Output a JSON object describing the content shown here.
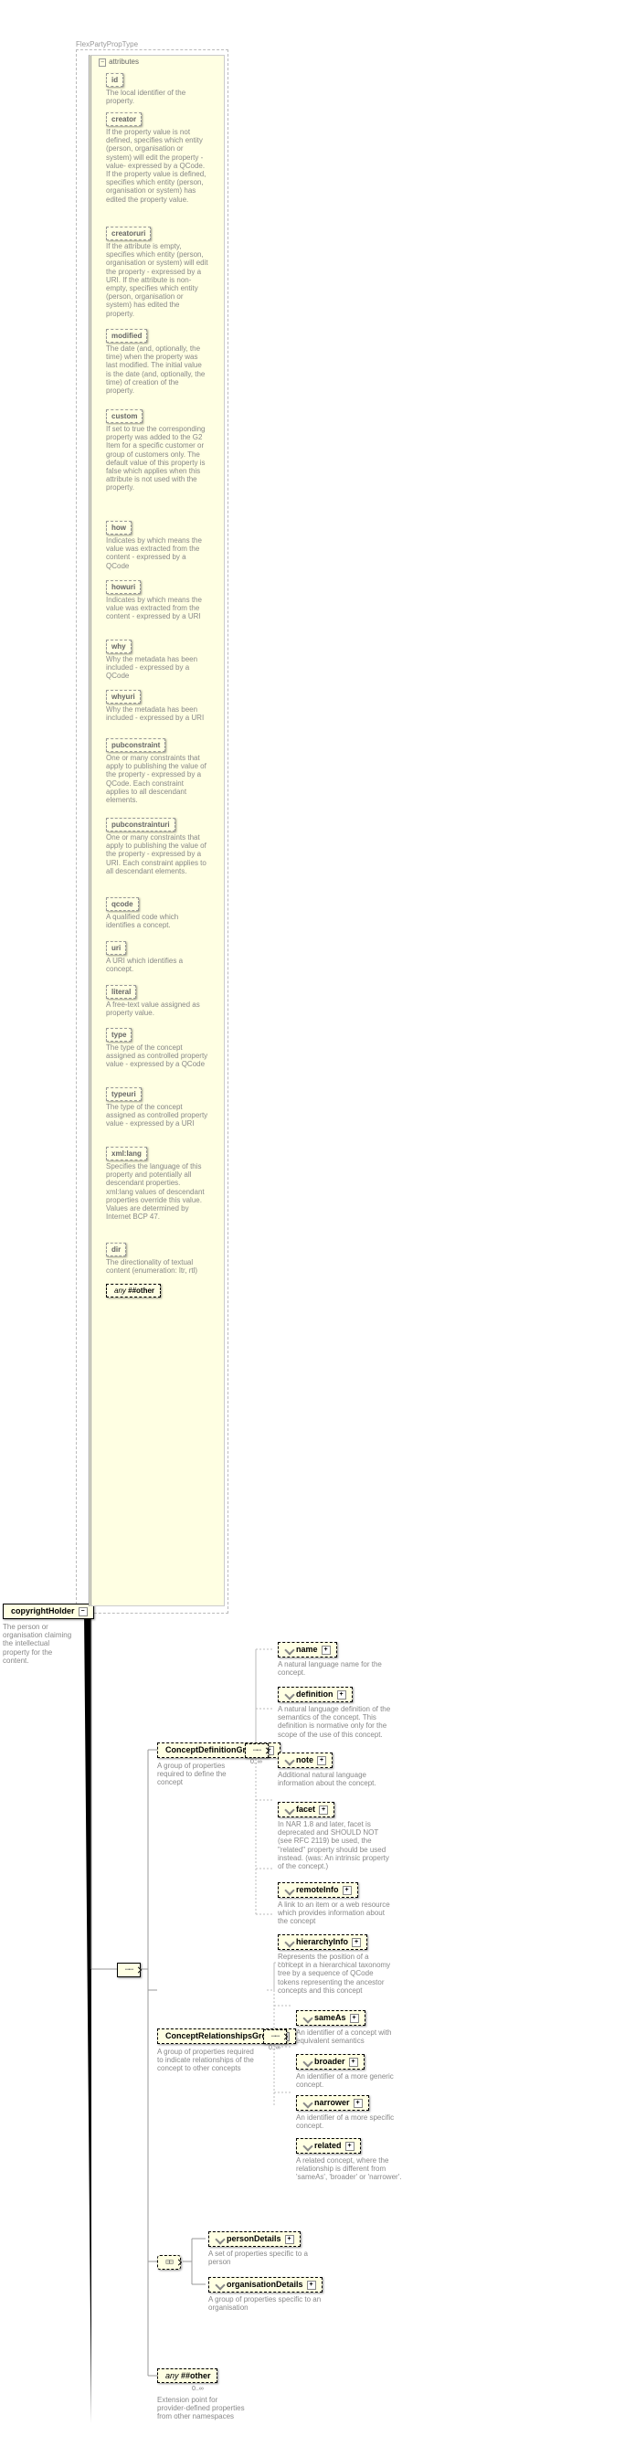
{
  "root": {
    "type_label": "FlexPartyPropType",
    "name": "copyrightHolder",
    "desc": "The person or organisation claiming the intellectual property for the content."
  },
  "attr_header": "attributes",
  "attrs": [
    {
      "name": "id",
      "desc": "The local identifier of the property."
    },
    {
      "name": "creator",
      "desc": "If the property value is not defined, specifies which entity (person, organisation or system) will edit the property -value- expressed by a QCode. If the property value is defined, specifies which entity (person, organisation or system) has edited the property value."
    },
    {
      "name": "creatoruri",
      "desc": "If the attribute is empty, specifies which entity (person, organisation or system) will edit the property - expressed by a URI. If the attribute is non-empty, specifies which entity (person, organisation or system) has edited the property."
    },
    {
      "name": "modified",
      "desc": "The date (and, optionally, the time) when the property was last modified. The initial value is the date (and, optionally, the time) of creation of the property."
    },
    {
      "name": "custom",
      "desc": "If set to true the corresponding property was added to the G2 Item for a specific customer or group of customers only. The default value of this property is false which applies when this attribute is not used with the property."
    },
    {
      "name": "how",
      "desc": "Indicates by which means the value was extracted from the content - expressed by a QCode"
    },
    {
      "name": "howuri",
      "desc": "Indicates by which means the value was extracted from the content - expressed by a URI"
    },
    {
      "name": "why",
      "desc": "Why the metadata has been included - expressed by a QCode"
    },
    {
      "name": "whyuri",
      "desc": "Why the metadata has been included - expressed by a URI"
    },
    {
      "name": "pubconstraint",
      "desc": "One or many constraints that apply to publishing the value of the property - expressed by a QCode. Each constraint applies to all descendant elements."
    },
    {
      "name": "pubconstrainturi",
      "desc": "One or many constraints that apply to publishing the value of the property - expressed by a URI. Each constraint applies to all descendant elements."
    },
    {
      "name": "qcode",
      "desc": "A qualified code which identifies a concept."
    },
    {
      "name": "uri",
      "desc": "A URI which identifies a concept."
    },
    {
      "name": "literal",
      "desc": "A free-text value assigned as property value."
    },
    {
      "name": "type",
      "desc": "The type of the concept assigned as controlled property value - expressed by a QCode"
    },
    {
      "name": "typeuri",
      "desc": "The type of the concept assigned as controlled property value - expressed by a URI"
    },
    {
      "name": "xml:lang",
      "desc": "Specifies the language of this property and potentially all descendant properties. xml:lang values of descendant properties override this value. Values are determined by Internet BCP 47."
    },
    {
      "name": "dir",
      "desc": "The directionality of textual content (enumeration: ltr, rtl)"
    }
  ],
  "any_attr": "##other",
  "groups": {
    "cdg": {
      "name": "ConceptDefinitionGroup",
      "desc": "A group of properties required to define the concept",
      "card": "0..∞"
    },
    "crg": {
      "name": "ConceptRelationshipsGroup",
      "desc": "A group of properties required to indicate relationships of the concept to other concepts",
      "card": "0..∞"
    }
  },
  "cdg_children": [
    {
      "name": "name",
      "desc": "A natural language name for the concept.",
      "tick": true,
      "expand": true
    },
    {
      "name": "definition",
      "desc": "A natural language definition of the semantics of the concept. This definition is normative only for the scope of the use of this concept.",
      "tick": true,
      "expand": true
    },
    {
      "name": "note",
      "desc": "Additional natural language information about the concept.",
      "tick": true,
      "expand": true
    },
    {
      "name": "facet",
      "desc": "In NAR 1.8 and later, facet is deprecated and SHOULD NOT (see RFC 2119) be used, the \"related\" property should be used instead. (was: An intrinsic property of the concept.)",
      "tick": true,
      "expand": true
    },
    {
      "name": "remoteInfo",
      "desc": "A link to an item or a web resource which provides information about the concept",
      "tick": true,
      "expand": true
    },
    {
      "name": "hierarchyInfo",
      "desc": "Represents the position of a concept in a hierarchical taxonomy tree by a sequence of QCode tokens representing the ancestor concepts and this concept",
      "tick": true,
      "expand": true
    }
  ],
  "crg_children": [
    {
      "name": "sameAs",
      "desc": "An identifier of a concept with equivalent semantics",
      "tick": true,
      "expand": true
    },
    {
      "name": "broader",
      "desc": "An identifier of a more generic concept.",
      "tick": true,
      "expand": true
    },
    {
      "name": "narrower",
      "desc": "An identifier of a more specific concept.",
      "tick": true,
      "expand": true
    },
    {
      "name": "related",
      "desc": "A related concept, where the relationship is different from 'sameAs', 'broader' or 'narrower'.",
      "tick": true,
      "expand": true
    }
  ],
  "choice_children": [
    {
      "name": "personDetails",
      "desc": "A set of properties specific to a person",
      "tick": true,
      "expand": true
    },
    {
      "name": "organisationDetails",
      "desc": "A group of properties specific to an organisation",
      "tick": true,
      "expand": true
    }
  ],
  "any_elem": {
    "name": "##other",
    "desc": "Extension point for provider-defined properties from other namespaces",
    "card": "0..∞"
  },
  "any_prefix": "any"
}
